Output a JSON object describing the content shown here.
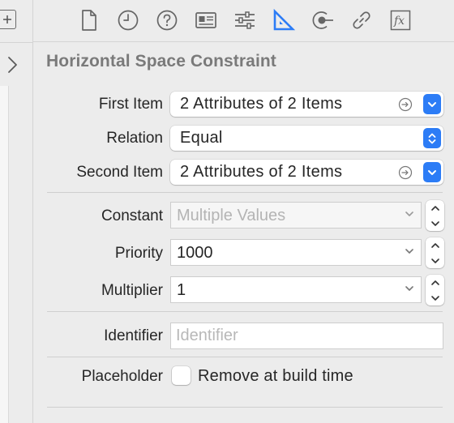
{
  "toolbar": {
    "icons": [
      "file-inspector-icon",
      "history-inspector-icon",
      "quick-help-icon",
      "identity-inspector-icon",
      "attributes-inspector-icon",
      "size-inspector-icon",
      "connections-inspector-icon",
      "bindings-inspector-icon",
      "effects-inspector-icon"
    ],
    "effects_glyph": "fx",
    "accent_color": "#2c7cf6"
  },
  "panel": {
    "title": "Horizontal Space Constraint"
  },
  "first_item": {
    "label": "First Item",
    "value": "2 Attributes of 2 Items"
  },
  "relation": {
    "label": "Relation",
    "value": "Equal"
  },
  "second_item": {
    "label": "Second Item",
    "value": "2 Attributes of 2 Items"
  },
  "constant": {
    "label": "Constant",
    "placeholder": "Multiple Values"
  },
  "priority": {
    "label": "Priority",
    "value": "1000"
  },
  "multiplier": {
    "label": "Multiplier",
    "value": "1"
  },
  "identifier": {
    "label": "Identifier",
    "placeholder": "Identifier"
  },
  "placeholder": {
    "label": "Placeholder",
    "checkbox_label": "Remove at build time",
    "checked": false
  }
}
